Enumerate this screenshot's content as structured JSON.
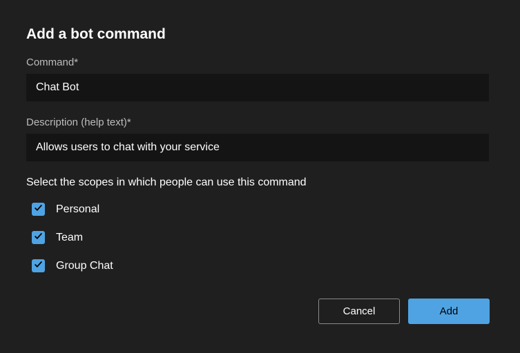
{
  "dialog": {
    "title": "Add a bot command",
    "fields": {
      "command": {
        "label": "Command*",
        "value": "Chat Bot"
      },
      "description": {
        "label": "Description (help text)*",
        "value": "Allows users to chat with your service"
      }
    },
    "scopes": {
      "instruction": "Select the scopes in which people can use this command",
      "items": [
        {
          "label": "Personal",
          "checked": true
        },
        {
          "label": "Team",
          "checked": true
        },
        {
          "label": "Group Chat",
          "checked": true
        }
      ]
    },
    "buttons": {
      "cancel": "Cancel",
      "add": "Add"
    }
  },
  "colors": {
    "accent": "#4fa3e3",
    "background": "#1f1f1f",
    "input_background": "#141414"
  }
}
